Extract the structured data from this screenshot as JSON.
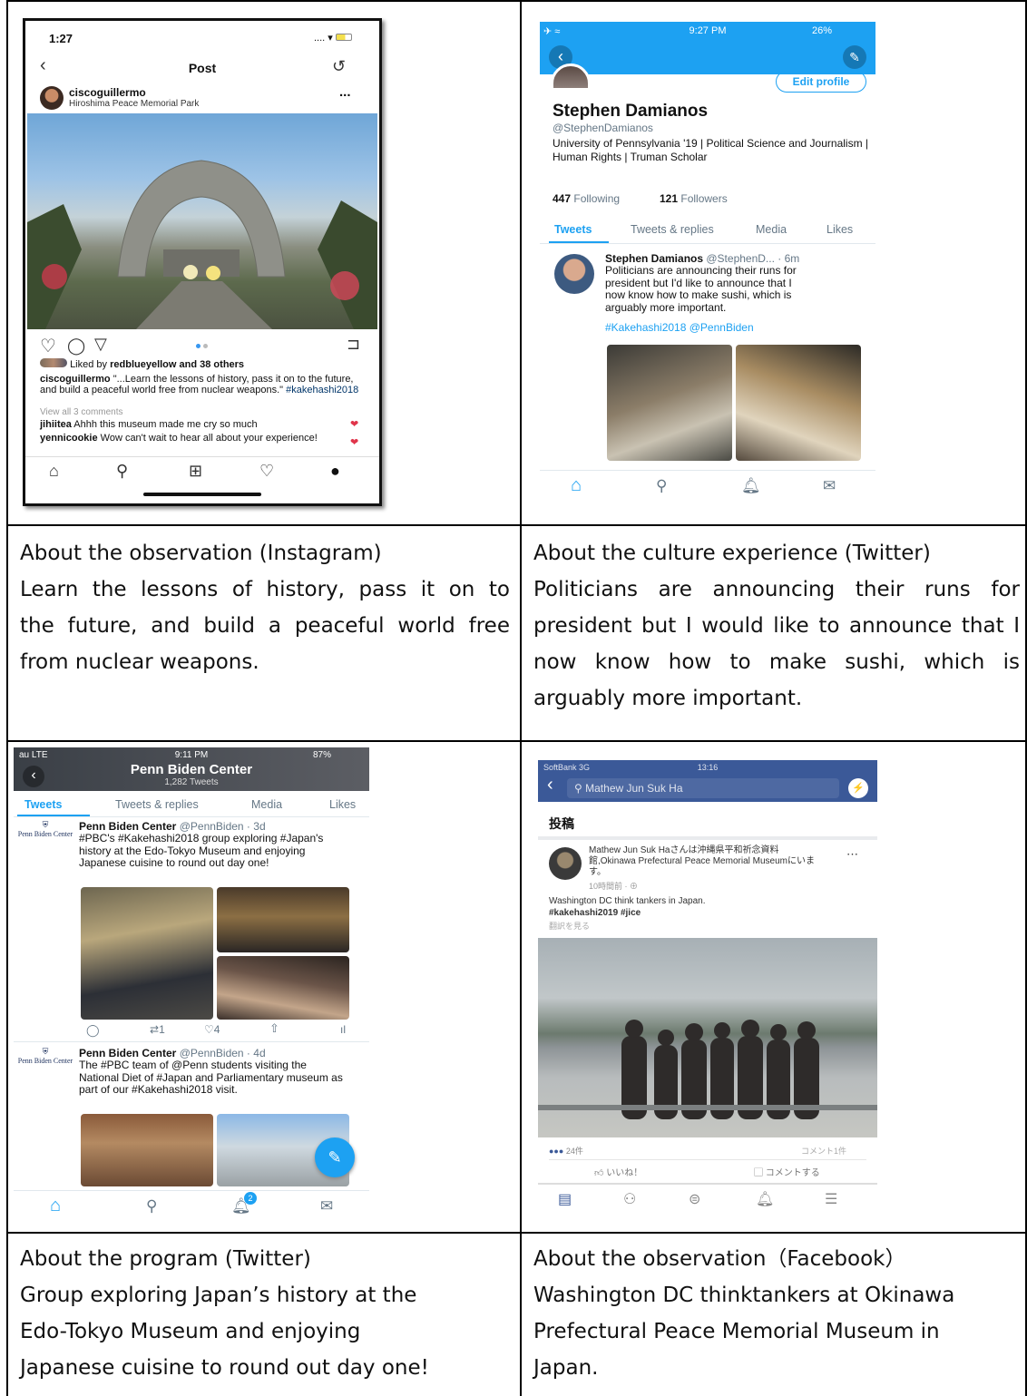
{
  "cells": [
    {
      "caption_title": "About the observation (Instagram)",
      "caption_lines": [
        "Learn the lessons of history, pass it on to",
        "the future, and build a peaceful world free",
        "from nuclear weapons."
      ],
      "screenshot": {
        "time": "1:27",
        "header": "Post",
        "username": "ciscoguillermo",
        "location": "Hiroshima Peace Memorial Park",
        "more": "...",
        "liked_by": "Liked by",
        "liked_user": "redblueyellow",
        "liked_rest": "and 38 others",
        "caption_user": "ciscoguillermo",
        "caption_text": "\"...Learn the lessons of history, pass it on to the future, and build a peaceful world free from nuclear weapons.\"",
        "hashtag": "#kakehashi2018",
        "view_comments": "View all 3 comments",
        "comment1_user": "jihiitea",
        "comment1_text": "Ahhh this museum made me cry so much",
        "comment2_user": "yennicookie",
        "comment2_text": "Wow can't wait to hear all about your experience!"
      }
    },
    {
      "caption_title": "About the culture experience (Twitter)",
      "caption_lines": [
        "Politicians are announcing their runs for",
        "president but I would like to announce that I",
        "now know how to make sushi, which is",
        "arguably more important."
      ],
      "screenshot": {
        "time": "9:27 PM",
        "battery": "26%",
        "edit_profile": "Edit profile",
        "name": "Stephen Damianos",
        "handle": "@StephenDamianos",
        "bio": "University of Pennsylvania '19 | Political Science and Journalism | Human Rights | Truman Scholar",
        "following_count": "447",
        "following_label": "Following",
        "followers_count": "121",
        "followers_label": "Followers",
        "tabs": [
          "Tweets",
          "Tweets & replies",
          "Media",
          "Likes"
        ],
        "tweet_name": "Stephen Damianos",
        "tweet_meta": "@StephenD... · 6m",
        "tweet_text": "Politicians are announcing their runs for president but I'd like to announce that I now know how to make sushi, which is arguably more important.",
        "tweet_tags": "#Kakehashi2018 @PennBiden"
      }
    },
    {
      "caption_title": "About the program (Twitter)",
      "caption_lines": [
        "Group exploring Japan’s history at the",
        "Edo-Tokyo Museum and enjoying",
        "Japanese cuisine to round out day one!"
      ],
      "screenshot": {
        "carrier": "au LTE",
        "time": "9:11 PM",
        "battery": "87%",
        "title": "Penn Biden Center",
        "subtitle": "1,282 Tweets",
        "tabs": [
          "Tweets",
          "Tweets & replies",
          "Media",
          "Likes"
        ],
        "logo": "Penn Biden Center",
        "t1_name": "Penn Biden Center",
        "t1_meta": "@PennBiden · 3d",
        "t1_text": "#PBC's #Kakehashi2018 group exploring #Japan's history at the Edo-Tokyo Museum and enjoying Japanese cuisine to round out day one!",
        "t1_retweets": "1",
        "t1_likes": "4",
        "t2_name": "Penn Biden Center",
        "t2_meta": "@PennBiden · 4d",
        "t2_text": "The #PBC team of @Penn students visiting the National Diet of #Japan and Parliamentary museum as part of our #Kakehashi2018 visit.",
        "notif_badge": "2"
      }
    },
    {
      "caption_title": "About the observation（Facebook）",
      "caption_lines": [
        "Washington DC thinktankers at Okinawa",
        "Prefectural Peace Memorial Museum in",
        "Japan."
      ],
      "screenshot": {
        "carrier": "SoftBank 3G",
        "time": "13:16",
        "search_text": "Mathew Jun Suk Ha",
        "section": "投稿",
        "post_author": "Mathew Jun Suk Haさんは沖縄県平和祈念資料館,Okinawa Prefectural Peace Memorial Museumにいます。",
        "post_time": "10時間前 · ",
        "post_text": "Washington DC think tankers in Japan.",
        "post_tags": "#kakehashi2019 #jice",
        "translate": "翻訳を見る",
        "reactions": "24件",
        "comments": "コメント1件",
        "like": "いいね！",
        "comment": "コメントする"
      }
    }
  ]
}
